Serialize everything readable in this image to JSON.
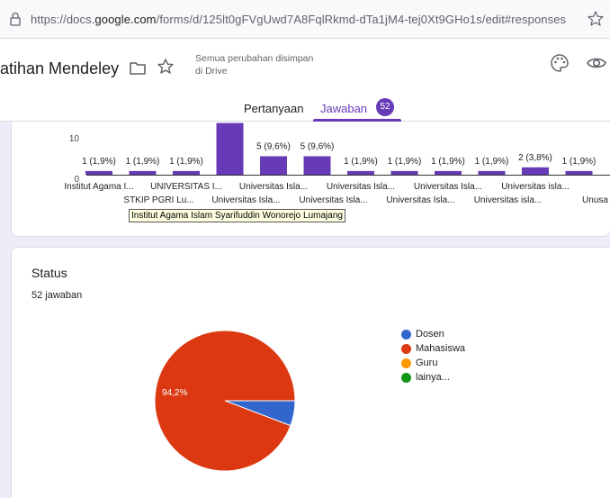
{
  "browser": {
    "url_pre": "https://docs.",
    "url_host": "google.com",
    "url_post": "/forms/d/125lt0gFVgUwd7A8FqlRkmd-dTa1jM4-tej0Xt9GHo1s/edit#responses"
  },
  "form": {
    "title": "atihan Mendeley",
    "saved_line1": "Semua perubahan disimpan",
    "saved_line2": "di Drive",
    "tabs": [
      {
        "label": "Pertanyaan"
      },
      {
        "label": "Jawaban"
      }
    ],
    "response_badge": "52"
  },
  "tooltip": "Institut Agama Islam Syarifuddin Wonorejo Lumajang",
  "chart_data": [
    {
      "type": "bar",
      "ylim": [
        0,
        10
      ],
      "y_ticks": [
        "10",
        "0"
      ],
      "categories": [
        "Institut Agama I...",
        "STKIP PGRI Lu...",
        "UNIVERSITAS I...",
        "Universitas Isla...",
        "Universitas Isla...",
        "Universitas Isla...",
        "Universitas Isla...",
        "Universitas Isla...",
        "Universitas Isla...",
        "Universitas isla...",
        "Universitas isla...",
        "Unusa"
      ],
      "values": [
        1,
        1,
        1,
        14,
        5,
        5,
        1,
        1,
        1,
        1,
        2,
        1
      ],
      "data_labels": [
        "1 (1,9%)",
        "1 (1,9%)",
        "1 (1,9%)",
        "",
        "5 (9,6%)",
        "5 (9,6%)",
        "1 (1,9%)",
        "1 (1,9%)",
        "1 (1,9%)",
        "1 (1,9%)",
        "2 (3,8%)",
        "1 (1,9%)"
      ],
      "color": "#673ab7"
    },
    {
      "type": "pie",
      "title": "Status",
      "subtitle": "52 jawaban",
      "slices": [
        {
          "label": "Dosen",
          "value": 3,
          "color": "#3366cc"
        },
        {
          "label": "Mahasiswa",
          "value": 49,
          "color": "#dc3912"
        },
        {
          "label": "Guru",
          "value": 0,
          "color": "#ff9900"
        },
        {
          "label": "lainya...",
          "value": 0,
          "color": "#109618"
        }
      ],
      "slice_label": "94,2%",
      "legend_position": "right"
    }
  ]
}
